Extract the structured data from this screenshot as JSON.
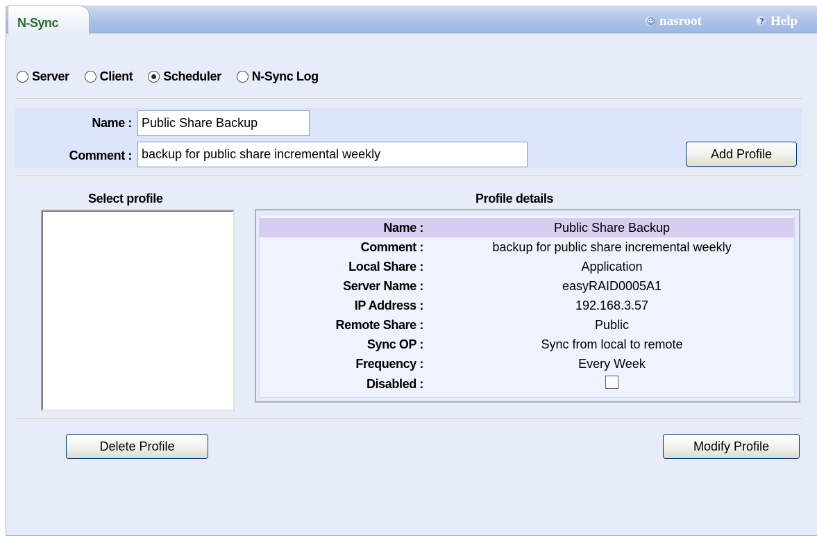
{
  "header": {
    "tab_label": "N-Sync",
    "user_label": "nasroot",
    "help_label": "Help"
  },
  "modes": [
    {
      "label": "Server",
      "checked": false
    },
    {
      "label": "Client",
      "checked": false
    },
    {
      "label": "Scheduler",
      "checked": true
    },
    {
      "label": "N-Sync Log",
      "checked": false
    }
  ],
  "form": {
    "name_label": "Name :",
    "name_value": "Public Share Backup",
    "comment_label": "Comment :",
    "comment_value": "backup for public share incremental weekly",
    "add_button": "Add Profile"
  },
  "select_profile": {
    "title": "Select profile",
    "items": []
  },
  "details": {
    "title": "Profile details",
    "rows": [
      {
        "key": "Name :",
        "value": "Public Share Backup"
      },
      {
        "key": "Comment :",
        "value": "backup for public share incremental weekly"
      },
      {
        "key": "Local Share :",
        "value": "Application"
      },
      {
        "key": "Server Name :",
        "value": "easyRAID0005A1"
      },
      {
        "key": "IP Address :",
        "value": "192.168.3.57"
      },
      {
        "key": "Remote Share :",
        "value": "Public"
      },
      {
        "key": "Sync OP :",
        "value": "Sync from local to remote"
      },
      {
        "key": "Frequency :",
        "value": "Every Week"
      }
    ],
    "disabled_label": "Disabled :",
    "disabled_checked": false
  },
  "actions": {
    "delete_button": "Delete Profile",
    "modify_button": "Modify Profile"
  }
}
